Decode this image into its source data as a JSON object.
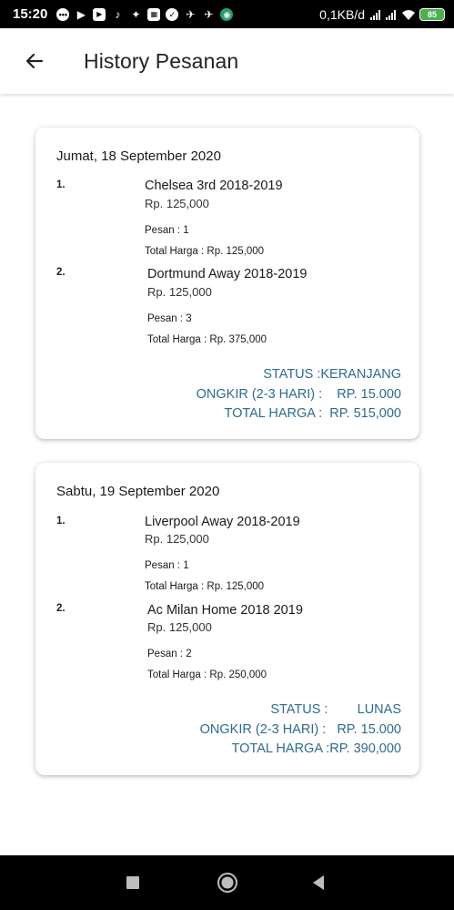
{
  "status_bar": {
    "time": "15:20",
    "net_speed": "0,1KB/d",
    "battery": "85"
  },
  "app_bar": {
    "title": "History Pesanan"
  },
  "orders": [
    {
      "date": "Jumat, 18 September 2020",
      "items": [
        {
          "no": "1.",
          "name": "Chelsea 3rd 2018-2019",
          "price": "Rp. 125,000",
          "qty": "Pesan : 1",
          "total": "Total Harga : Rp. 125,000"
        },
        {
          "no": "2.",
          "name": "Dortmund Away 2018-2019",
          "price": "Rp. 125,000",
          "qty": "Pesan : 3",
          "total": "Total Harga : Rp. 375,000"
        }
      ],
      "status": "STATUS :KERANJANG",
      "ongkir": "ONGKIR (2-3 HARI) :    RP. 15.000",
      "total_harga": "TOTAL HARGA :  RP. 515,000"
    },
    {
      "date": "Sabtu, 19 September 2020",
      "items": [
        {
          "no": "1.",
          "name": "Liverpool Away 2018-2019",
          "price": "Rp. 125,000",
          "qty": "Pesan : 1",
          "total": "Total Harga : Rp. 125,000"
        },
        {
          "no": "2.",
          "name": "Ac Milan Home 2018 2019",
          "price": "Rp. 125,000",
          "qty": "Pesan : 2",
          "total": "Total Harga : Rp. 250,000"
        }
      ],
      "status": "STATUS :        LUNAS",
      "ongkir": "ONGKIR (2-3 HARI) :   RP. 15.000",
      "total_harga": "TOTAL HARGA :RP. 390,000"
    }
  ],
  "colors": {
    "summary_text": "#2e6a8e",
    "battery": "#4caf50"
  },
  "icons": {
    "back": "arrow-left-icon",
    "nav_home": "circle-home-icon",
    "nav_recents": "square-recents-icon",
    "nav_back": "triangle-back-icon"
  }
}
